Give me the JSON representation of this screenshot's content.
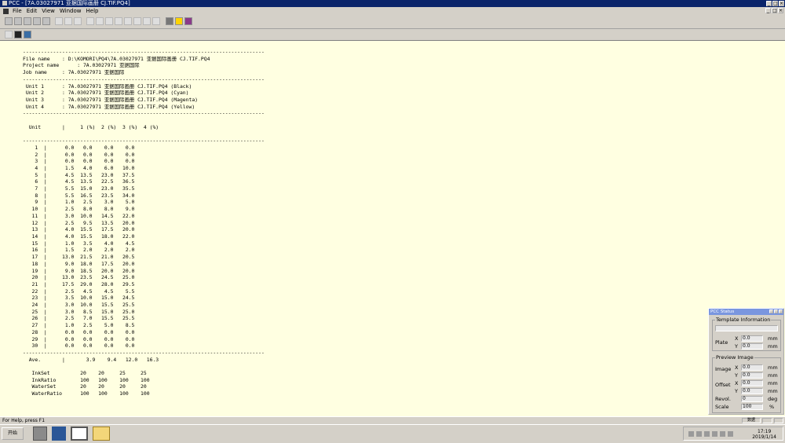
{
  "window": {
    "title": "PCC - [7A.03027971 亚据国际画册 CJ.TIF.PQ4]"
  },
  "menu": {
    "items": [
      "File",
      "Edit",
      "View",
      "Window",
      "Help"
    ]
  },
  "report": {
    "separator": "--------------------------------------------------------------------------------",
    "header_lines": [
      "File name    : D:\\KOMORI\\PQ4\\7A.03027971 亚据国际画册 CJ.TIF.PQ4",
      "Project name      : 7A.03027971 亚据国际",
      "Job name     : 7A.03027971 亚据国际"
    ],
    "unit_lines": [
      " Unit 1      : 7A.03027971 亚据国际画册 CJ.TIF.PQ4 (Black)",
      " Unit 2      : 7A.03027971 亚据国际画册 CJ.TIF.PQ4 (Cyan)",
      " Unit 3      : 7A.03027971 亚据国际画册 CJ.TIF.PQ4 (Magenta)",
      " Unit 4      : 7A.03027971 亚据国际画册 CJ.TIF.PQ4 (Yellow)"
    ],
    "table_header": "  Unit       |     1 (%)  2 (%)  3 (%)  4 (%)",
    "rows": [
      "    1  |      0.0   0.0    0.0    0.0",
      "    2  |      0.0   0.0    0.0    0.0",
      "    3  |      0.0   0.0    0.0    0.0",
      "    4  |      1.5   4.0    6.0   10.0",
      "    5  |      4.5  13.5   23.0   37.5",
      "    6  |      4.5  13.5   22.5   36.5",
      "    7  |      5.5  15.0   23.0   35.5",
      "    8  |      5.5  16.5   23.5   34.0",
      "    9  |      1.0   2.5    3.0    5.0",
      "   10  |      2.5   8.0    8.0    9.0",
      "   11  |      3.0  10.0   14.5   22.0",
      "   12  |      2.5   9.5   13.5   20.0",
      "   13  |      4.0  15.5   17.5   20.0",
      "   14  |      4.0  15.5   18.0   22.0",
      "   15  |      1.0   3.5    4.0    4.5",
      "   16  |      1.5   2.0    2.0    2.0",
      "   17  |     13.0  21.5   21.0   20.5",
      "   18  |      9.0  18.0   17.5   20.0",
      "   19  |      9.0  18.5   20.0   20.0",
      "   20  |     13.0  23.5   24.5   25.0",
      "   21  |     17.5  29.0   28.0   29.5",
      "   22  |      2.5   4.5    4.5    5.5",
      "   23  |      3.5  10.0   15.0   24.5",
      "   24  |      3.0  10.0   15.5   25.5",
      "   25  |      3.0   8.5   15.0   25.0",
      "   26  |      2.5   7.0   15.5   25.5",
      "   27  |      1.0   2.5    5.0    8.5",
      "   28  |      0.0   0.0    0.0    0.0",
      "   29  |      0.0   0.0    0.0    0.0",
      "   30  |      0.0   0.0    0.0    0.0"
    ],
    "average_line": "  Ave.       |       3.9    9.4   12.0   16.3",
    "settings_lines": [
      "   InkSet          20    20     25     25",
      "   InkRatio        100   100    100    100",
      "   WaterSet        20    20     20     20",
      "   WaterRatio      100   100    100    100"
    ]
  },
  "status_window": {
    "title": "PCC Status",
    "template_group": "Template Information",
    "plate_label": "Plate",
    "preview_group": "Preview Image",
    "image_label": "Image",
    "offset_label": "Offset",
    "revol_label": "Revol.",
    "scale_label": "Scale",
    "x": "X",
    "y": "Y",
    "unit_mm": "mm",
    "unit_deg": "deg",
    "unit_pct": "%",
    "plate_x": "0.0",
    "plate_y": "0.0",
    "image_x": "0.0",
    "image_y": "0.0",
    "offset_x": "0.0",
    "offset_y": "0.0",
    "revol": "0",
    "scale": "100"
  },
  "statusbar": {
    "help_text": "For Help, press F1",
    "indicator": "数据"
  },
  "taskbar": {
    "start_label": "开始",
    "clock_time": "17:19",
    "clock_date": "2019/1/14"
  }
}
